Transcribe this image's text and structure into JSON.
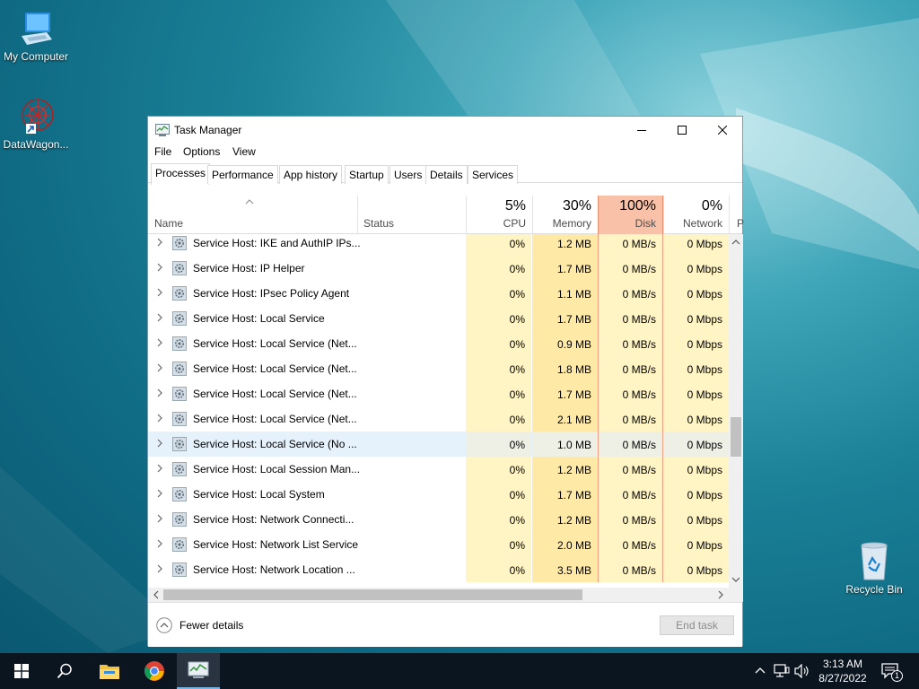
{
  "desktop": {
    "icons": [
      {
        "label": "My Computer"
      },
      {
        "label": "DataWagon..."
      },
      {
        "label": "Recycle Bin"
      }
    ]
  },
  "window": {
    "title": "Task Manager",
    "menu": [
      "File",
      "Options",
      "View"
    ],
    "tabs": [
      "Processes",
      "Performance",
      "App history",
      "Startup",
      "Users",
      "Details",
      "Services"
    ],
    "active_tab": "Processes",
    "columns": {
      "name": "Name",
      "status": "Status",
      "cpu": {
        "pct": "5%",
        "label": "CPU"
      },
      "memory": {
        "pct": "30%",
        "label": "Memory"
      },
      "disk": {
        "pct": "100%",
        "label": "Disk"
      },
      "network": {
        "pct": "0%",
        "label": "Network"
      },
      "next_col_initial": "P"
    },
    "processes": [
      {
        "name": "Service Host: IKE and AuthIP IPs...",
        "cpu": "0%",
        "memory": "1.2 MB",
        "disk": "0 MB/s",
        "network": "0 Mbps"
      },
      {
        "name": "Service Host: IP Helper",
        "cpu": "0%",
        "memory": "1.7 MB",
        "disk": "0 MB/s",
        "network": "0 Mbps"
      },
      {
        "name": "Service Host: IPsec Policy Agent",
        "cpu": "0%",
        "memory": "1.1 MB",
        "disk": "0 MB/s",
        "network": "0 Mbps"
      },
      {
        "name": "Service Host: Local Service",
        "cpu": "0%",
        "memory": "1.7 MB",
        "disk": "0 MB/s",
        "network": "0 Mbps"
      },
      {
        "name": "Service Host: Local Service (Net...",
        "cpu": "0%",
        "memory": "0.9 MB",
        "disk": "0 MB/s",
        "network": "0 Mbps"
      },
      {
        "name": "Service Host: Local Service (Net...",
        "cpu": "0%",
        "memory": "1.8 MB",
        "disk": "0 MB/s",
        "network": "0 Mbps"
      },
      {
        "name": "Service Host: Local Service (Net...",
        "cpu": "0%",
        "memory": "1.7 MB",
        "disk": "0 MB/s",
        "network": "0 Mbps"
      },
      {
        "name": "Service Host: Local Service (Net...",
        "cpu": "0%",
        "memory": "2.1 MB",
        "disk": "0 MB/s",
        "network": "0 Mbps"
      },
      {
        "name": "Service Host: Local Service (No ...",
        "cpu": "0%",
        "memory": "1.0 MB",
        "disk": "0 MB/s",
        "network": "0 Mbps",
        "selected": true
      },
      {
        "name": "Service Host: Local Session Man...",
        "cpu": "0%",
        "memory": "1.2 MB",
        "disk": "0 MB/s",
        "network": "0 Mbps"
      },
      {
        "name": "Service Host: Local System",
        "cpu": "0%",
        "memory": "1.7 MB",
        "disk": "0 MB/s",
        "network": "0 Mbps"
      },
      {
        "name": "Service Host: Network Connecti...",
        "cpu": "0%",
        "memory": "1.2 MB",
        "disk": "0 MB/s",
        "network": "0 Mbps"
      },
      {
        "name": "Service Host: Network List Service",
        "cpu": "0%",
        "memory": "2.0 MB",
        "disk": "0 MB/s",
        "network": "0 Mbps"
      },
      {
        "name": "Service Host: Network Location ...",
        "cpu": "0%",
        "memory": "3.5 MB",
        "disk": "0 MB/s",
        "network": "0 Mbps"
      }
    ],
    "footer": {
      "fewer_details": "Fewer details",
      "end_task": "End task"
    }
  },
  "taskbar": {
    "items": [
      "start-icon",
      "search-icon",
      "file-explorer-icon",
      "chrome-icon",
      "task-manager-icon"
    ],
    "clock": {
      "time": "3:13 AM",
      "date": "8/27/2022"
    },
    "notification_count": "1"
  },
  "colors": {
    "accent_highlight": "#e5f1fb",
    "cpu_heat": "#fff4c4",
    "memory_heat": "#ffe9a6",
    "disk_header_hot": "#f9c1a8"
  }
}
